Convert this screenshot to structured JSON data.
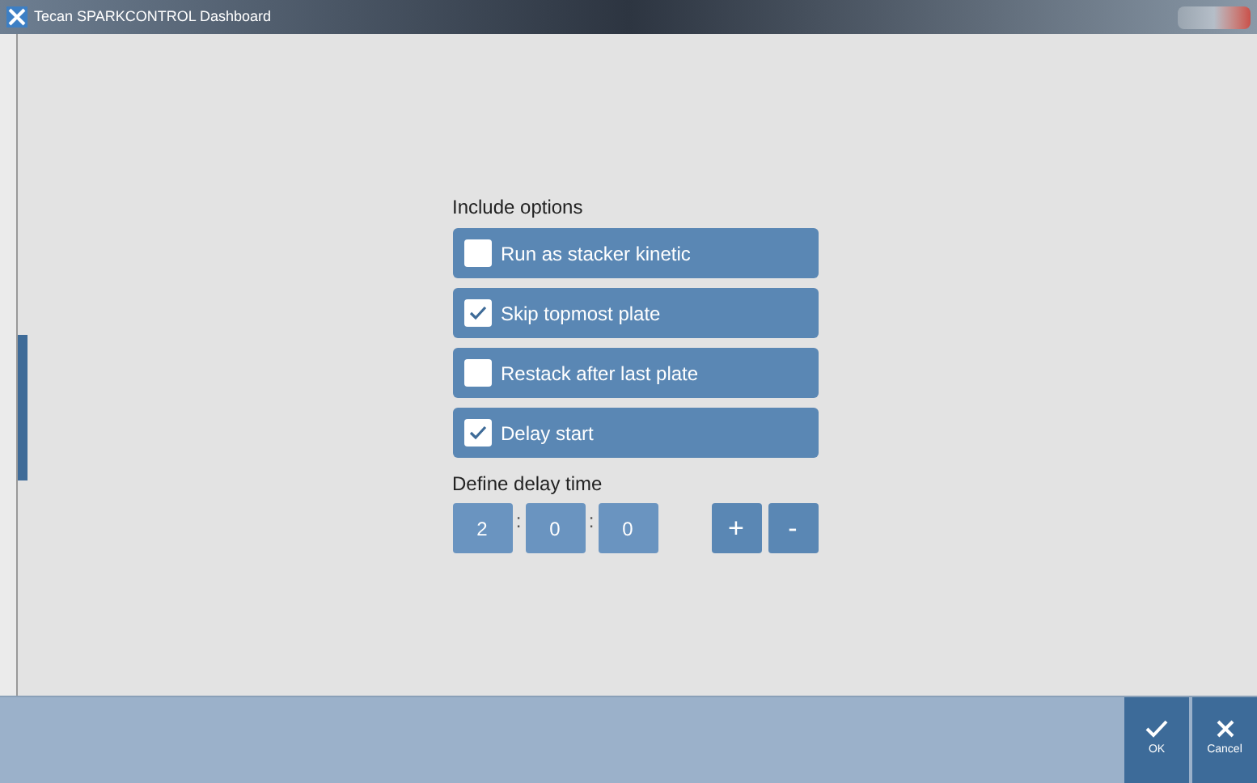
{
  "window": {
    "title": "Tecan SPARKCONTROL Dashboard"
  },
  "include_options": {
    "label": "Include options",
    "items": [
      {
        "label": "Run as stacker kinetic",
        "checked": false
      },
      {
        "label": "Skip topmost plate",
        "checked": true
      },
      {
        "label": "Restack after last plate",
        "checked": false
      },
      {
        "label": "Delay start",
        "checked": true
      }
    ]
  },
  "delay": {
    "label": "Define delay time",
    "fields": [
      "2",
      "0",
      "0"
    ],
    "separators": [
      ":",
      ":"
    ],
    "buttons": [
      "+",
      "-"
    ]
  },
  "footer_buttons": [
    {
      "kind": "ok",
      "label": "OK"
    },
    {
      "kind": "cancel",
      "label": "Cancel"
    }
  ]
}
